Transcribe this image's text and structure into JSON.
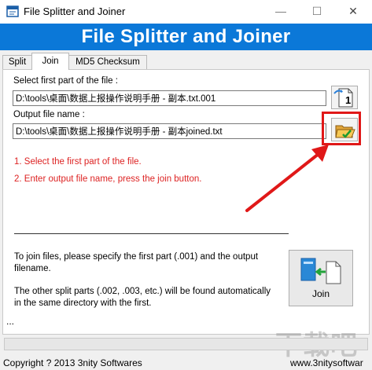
{
  "window": {
    "title": "File Splitter and Joiner",
    "minimize_glyph": "—",
    "maximize_glyph": "☐",
    "close_glyph": "✕"
  },
  "banner": {
    "title": "File Splitter and Joiner",
    "color": "#0b78d8"
  },
  "tabs": [
    {
      "label": "Split"
    },
    {
      "label": "Join",
      "selected": true
    },
    {
      "label": "MD5 Checksum"
    }
  ],
  "join": {
    "first_part_label": "Select first part of the file :",
    "first_part_value": "D:\\tools\\桌面\\数据上报操作说明手册 - 副本.txt.001",
    "output_label": "Output file name :",
    "output_value": "D:\\tools\\桌面\\数据上报操作说明手册 - 副本joined.txt",
    "first_part_icon_badge": "1",
    "instructions": [
      "1. Select the first part of the file.",
      "2. Enter output file name, press the join button."
    ],
    "info_line1": "To join files, please specify the first part (.001) and the output",
    "info_line2": "filename.",
    "info_line3": "The other split parts (.002, .003, etc.) will be found automatically",
    "info_line4": "in the same directory with the first.",
    "join_button_label": "Join",
    "ellipsis": "..."
  },
  "annotation": {
    "color": "#e01818"
  },
  "status": {
    "copyright": "Copyright ? 2013 3nity Softwares",
    "website": "www.3nitysoftwar"
  },
  "watermark": "下载吧"
}
